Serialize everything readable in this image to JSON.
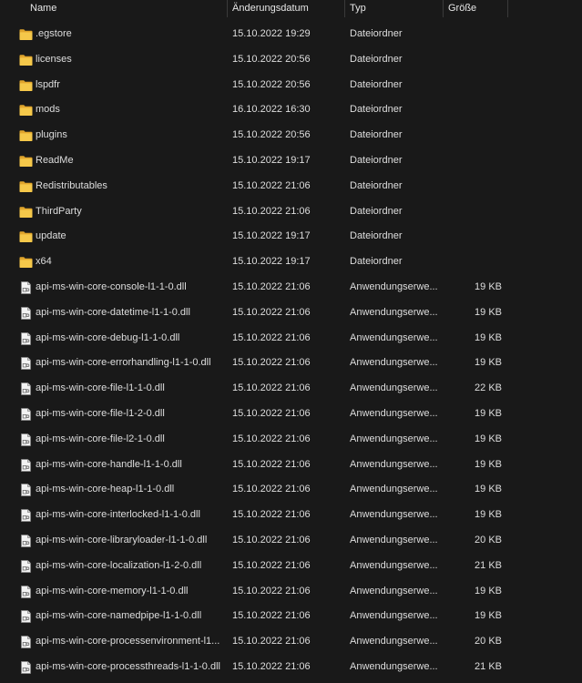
{
  "columns": {
    "name": "Name",
    "date": "Änderungsdatum",
    "type": "Typ",
    "size": "Größe"
  },
  "colors": {
    "background": "#191919",
    "text": "#dedede",
    "folder": "#f2c143",
    "file": "#e8e8e8"
  },
  "rows": [
    {
      "icon": "folder-icon",
      "name": ".egstore",
      "date": "15.10.2022 19:29",
      "type": "Dateiordner",
      "size": ""
    },
    {
      "icon": "folder-icon",
      "name": "licenses",
      "date": "15.10.2022 20:56",
      "type": "Dateiordner",
      "size": ""
    },
    {
      "icon": "folder-icon",
      "name": "lspdfr",
      "date": "15.10.2022 20:56",
      "type": "Dateiordner",
      "size": ""
    },
    {
      "icon": "folder-icon",
      "name": "mods",
      "date": "16.10.2022 16:30",
      "type": "Dateiordner",
      "size": ""
    },
    {
      "icon": "folder-icon",
      "name": "plugins",
      "date": "15.10.2022 20:56",
      "type": "Dateiordner",
      "size": ""
    },
    {
      "icon": "folder-icon",
      "name": "ReadMe",
      "date": "15.10.2022 19:17",
      "type": "Dateiordner",
      "size": ""
    },
    {
      "icon": "folder-icon",
      "name": "Redistributables",
      "date": "15.10.2022 21:06",
      "type": "Dateiordner",
      "size": ""
    },
    {
      "icon": "folder-icon",
      "name": "ThirdParty",
      "date": "15.10.2022 21:06",
      "type": "Dateiordner",
      "size": ""
    },
    {
      "icon": "folder-icon",
      "name": "update",
      "date": "15.10.2022 19:17",
      "type": "Dateiordner",
      "size": ""
    },
    {
      "icon": "folder-icon",
      "name": "x64",
      "date": "15.10.2022 19:17",
      "type": "Dateiordner",
      "size": ""
    },
    {
      "icon": "dll-file-icon",
      "name": "api-ms-win-core-console-l1-1-0.dll",
      "date": "15.10.2022 21:06",
      "type": "Anwendungserwe...",
      "size": "19 KB"
    },
    {
      "icon": "dll-file-icon",
      "name": "api-ms-win-core-datetime-l1-1-0.dll",
      "date": "15.10.2022 21:06",
      "type": "Anwendungserwe...",
      "size": "19 KB"
    },
    {
      "icon": "dll-file-icon",
      "name": "api-ms-win-core-debug-l1-1-0.dll",
      "date": "15.10.2022 21:06",
      "type": "Anwendungserwe...",
      "size": "19 KB"
    },
    {
      "icon": "dll-file-icon",
      "name": "api-ms-win-core-errorhandling-l1-1-0.dll",
      "date": "15.10.2022 21:06",
      "type": "Anwendungserwe...",
      "size": "19 KB"
    },
    {
      "icon": "dll-file-icon",
      "name": "api-ms-win-core-file-l1-1-0.dll",
      "date": "15.10.2022 21:06",
      "type": "Anwendungserwe...",
      "size": "22 KB"
    },
    {
      "icon": "dll-file-icon",
      "name": "api-ms-win-core-file-l1-2-0.dll",
      "date": "15.10.2022 21:06",
      "type": "Anwendungserwe...",
      "size": "19 KB"
    },
    {
      "icon": "dll-file-icon",
      "name": "api-ms-win-core-file-l2-1-0.dll",
      "date": "15.10.2022 21:06",
      "type": "Anwendungserwe...",
      "size": "19 KB"
    },
    {
      "icon": "dll-file-icon",
      "name": "api-ms-win-core-handle-l1-1-0.dll",
      "date": "15.10.2022 21:06",
      "type": "Anwendungserwe...",
      "size": "19 KB"
    },
    {
      "icon": "dll-file-icon",
      "name": "api-ms-win-core-heap-l1-1-0.dll",
      "date": "15.10.2022 21:06",
      "type": "Anwendungserwe...",
      "size": "19 KB"
    },
    {
      "icon": "dll-file-icon",
      "name": "api-ms-win-core-interlocked-l1-1-0.dll",
      "date": "15.10.2022 21:06",
      "type": "Anwendungserwe...",
      "size": "19 KB"
    },
    {
      "icon": "dll-file-icon",
      "name": "api-ms-win-core-libraryloader-l1-1-0.dll",
      "date": "15.10.2022 21:06",
      "type": "Anwendungserwe...",
      "size": "20 KB"
    },
    {
      "icon": "dll-file-icon",
      "name": "api-ms-win-core-localization-l1-2-0.dll",
      "date": "15.10.2022 21:06",
      "type": "Anwendungserwe...",
      "size": "21 KB"
    },
    {
      "icon": "dll-file-icon",
      "name": "api-ms-win-core-memory-l1-1-0.dll",
      "date": "15.10.2022 21:06",
      "type": "Anwendungserwe...",
      "size": "19 KB"
    },
    {
      "icon": "dll-file-icon",
      "name": "api-ms-win-core-namedpipe-l1-1-0.dll",
      "date": "15.10.2022 21:06",
      "type": "Anwendungserwe...",
      "size": "19 KB"
    },
    {
      "icon": "dll-file-icon",
      "name": "api-ms-win-core-processenvironment-l1...",
      "date": "15.10.2022 21:06",
      "type": "Anwendungserwe...",
      "size": "20 KB"
    },
    {
      "icon": "dll-file-icon",
      "name": "api-ms-win-core-processthreads-l1-1-0.dll",
      "date": "15.10.2022 21:06",
      "type": "Anwendungserwe...",
      "size": "21 KB"
    }
  ]
}
